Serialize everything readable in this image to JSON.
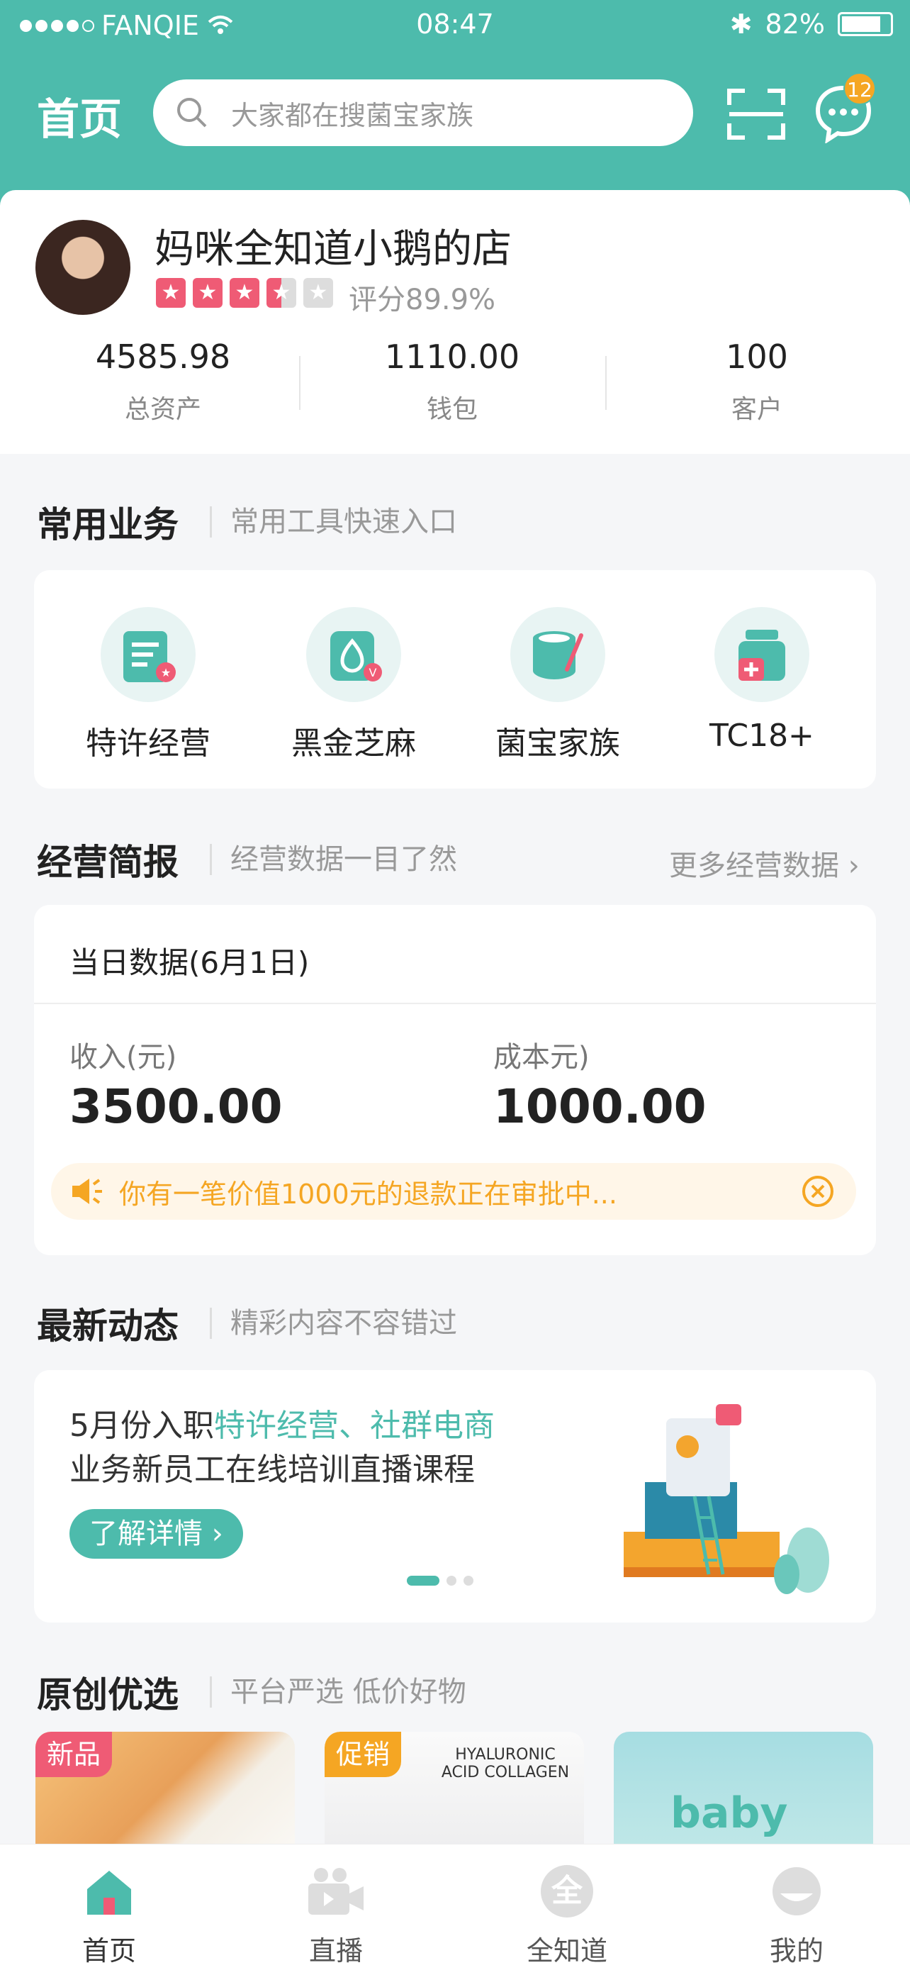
{
  "status": {
    "carrier": "FANQIE",
    "time": "08:47",
    "battery": "82%"
  },
  "header": {
    "title": "首页",
    "search_placeholder": "大家都在搜菌宝家族",
    "message_count": "12"
  },
  "profile": {
    "shop_name": "妈咪全知道小鹅的店",
    "rating_text": "评分89.9%",
    "stars": 3.5,
    "stats": [
      {
        "value": "4585.98",
        "label": "总资产"
      },
      {
        "value": "1110.00",
        "label": "钱包"
      },
      {
        "value": "100",
        "label": "客户"
      }
    ]
  },
  "common": {
    "title": "常用业务",
    "subtitle": "常用工具快速入口",
    "tools": [
      {
        "label": "特许经营",
        "icon": "license-icon"
      },
      {
        "label": "黑金芝麻",
        "icon": "sesame-icon"
      },
      {
        "label": "菌宝家族",
        "icon": "jar-icon"
      },
      {
        "label": "TC18+",
        "icon": "medicine-icon"
      }
    ]
  },
  "brief": {
    "title": "经营简报",
    "subtitle": "经营数据一目了然",
    "more": "更多经营数据",
    "day_label": "当日数据(6月1日)",
    "income_label": "收入(元)",
    "income_value": "3500.00",
    "cost_label": "成本元)",
    "cost_value": "1000.00",
    "notice": "你有一笔价值1000元的退款正在审批中..."
  },
  "news": {
    "title": "最新动态",
    "subtitle": "精彩内容不容错过",
    "line1_a": "5月份入职",
    "line1_b": "特许经营、社群电商",
    "line2": "业务新员工在线培训直播课程",
    "button": "了解详情"
  },
  "picks": {
    "title": "原创优选",
    "subtitle": "平台严选 低价好物",
    "items": [
      {
        "tag": "新品"
      },
      {
        "tag": "促销",
        "text": "HYALURONIC ACID COLLAGEN"
      },
      {
        "text": "baby"
      }
    ]
  },
  "tabbar": [
    {
      "label": "首页"
    },
    {
      "label": "直播"
    },
    {
      "label": "全知道",
      "glyph": "全"
    },
    {
      "label": "我的"
    }
  ],
  "colors": {
    "accent": "#4dbbac",
    "star": "#ef5b75",
    "warning": "#f5a623"
  }
}
